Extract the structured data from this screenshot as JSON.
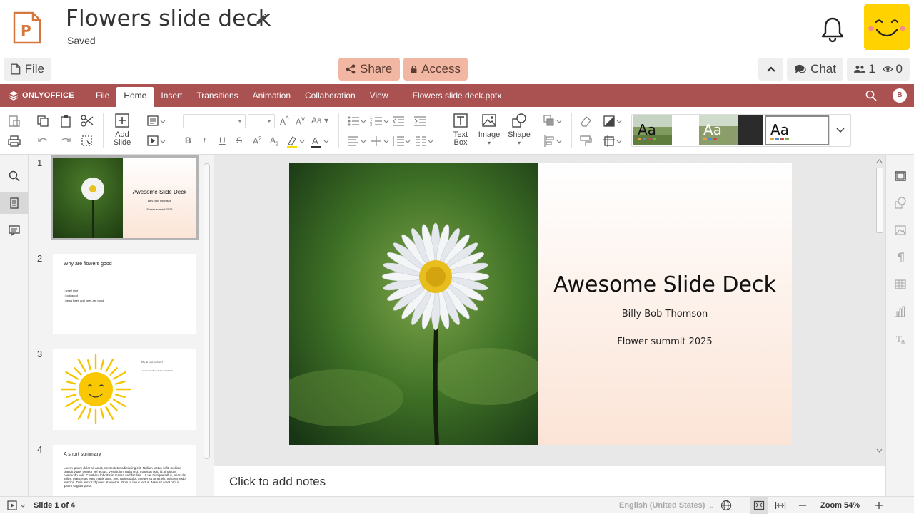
{
  "header": {
    "title": "Flowers slide deck",
    "status": "Saved",
    "file_label": "File",
    "share_label": "Share",
    "access_label": "Access",
    "chat_label": "Chat",
    "users_count": "1",
    "viewers_count": "0"
  },
  "menubar": {
    "brand": "ONLYOFFICE",
    "tabs": [
      "File",
      "Home",
      "Insert",
      "Transitions",
      "Animation",
      "Collaboration",
      "View"
    ],
    "active_tab": "Home",
    "file_name": "Flowers slide deck.pptx",
    "user_initial": "B"
  },
  "toolbar": {
    "add_slide_1": "Add",
    "add_slide_2": "Slide",
    "text_box_1": "Text",
    "text_box_2": "Box",
    "image_label": "Image",
    "shape_label": "Shape",
    "theme_sample": "Aa"
  },
  "slides": {
    "numbers": [
      "1",
      "2",
      "3",
      "4"
    ],
    "s1": {
      "title": "Awesome Slide Deck",
      "author": "Billy Bob Thomson",
      "event": "Flower summit 2025"
    },
    "s2": {
      "title": "Why are flowers good",
      "bullets": [
        "• smell nice",
        "• look good",
        "• helps bees and bees are good"
      ]
    },
    "s3": {
      "line1": "Why do I put sun here?",
      "line2": "I am the product, deals in this role"
    },
    "s4": {
      "title": "A short summary",
      "body": "Lorem ipsum dolor sit amet, consectetur adipiscing elit. Nullam lectus velit, mollis a blandit vitae, tempor vel lectus. Vestibulum nulla orci, mattis at odio id, tincidunt commodo velit. Curabitur lobortis in massa sed facilisis. Ut vel tristique tellus, a iaculis tellus. Maecenas eget mattis ante. Nec varius dolor. Integer sit amet elit, mi commodo suscipit. Duis auctor id purus at viverra. Proin ut lacus lectus. Nam sit amet orci id ipsum sagittis porta."
    }
  },
  "main_slide": {
    "title": "Awesome Slide Deck",
    "author": "Billy Bob Thomson",
    "event": "Flower summit 2025"
  },
  "notes_placeholder": "Click to add notes",
  "statusbar": {
    "slide_counter": "Slide 1 of 4",
    "language": "English (United States)",
    "zoom": "Zoom 54%"
  },
  "colors": {
    "brand_red": "#aa5252",
    "accent_orange": "#f2b7a2",
    "avatar_yellow": "#ffd200"
  }
}
